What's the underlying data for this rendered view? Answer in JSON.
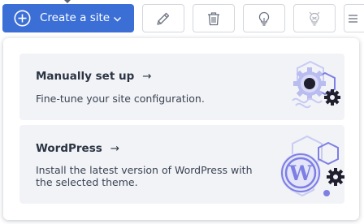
{
  "toolbar": {
    "create_label": "Create a site",
    "buttons": [
      {
        "icon": "pencil-icon",
        "enabled": true
      },
      {
        "icon": "trash-icon",
        "enabled": true
      },
      {
        "icon": "lightbulb-icon",
        "enabled": true
      },
      {
        "icon": "lightbulb-off-icon",
        "enabled": false
      }
    ]
  },
  "dropdown": {
    "options": [
      {
        "title": "Manually set up",
        "arrow": "→",
        "description": "Fine-tune your site configuration.",
        "illustration": "gears-illustration"
      },
      {
        "title": "WordPress",
        "arrow": "→",
        "description": "Install the latest version of WordPress with the selected theme.",
        "illustration": "wordpress-illustration"
      }
    ]
  },
  "colors": {
    "primary": "#3b6fd6",
    "option_bg": "#f2f3f6",
    "illustration_purple": "#7d7fe4",
    "illustration_light": "#c8cbf3"
  }
}
